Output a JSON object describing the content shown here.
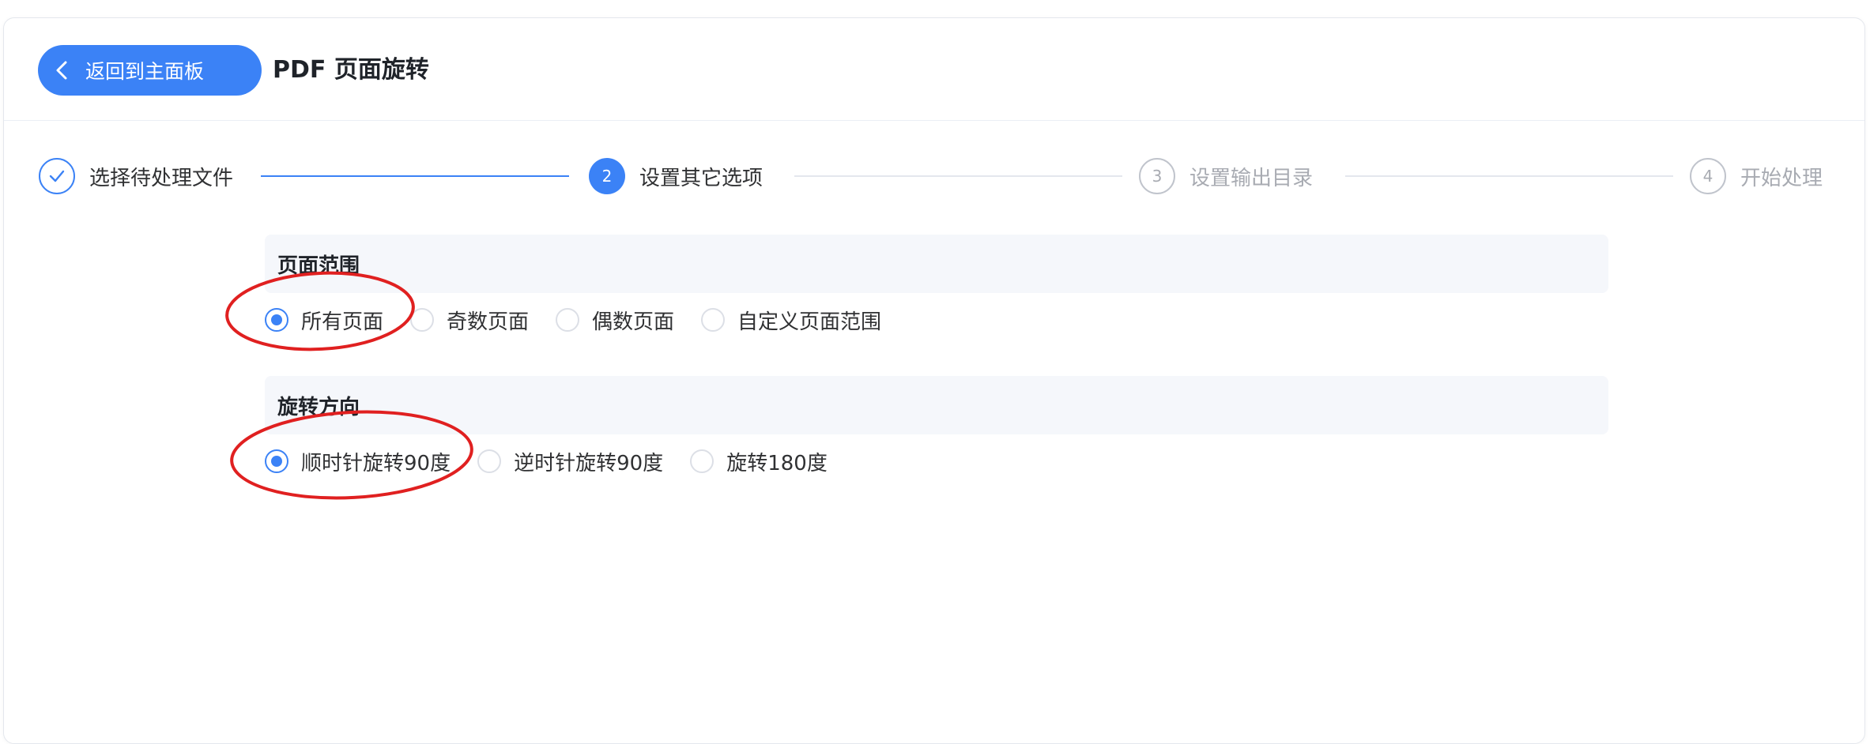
{
  "header": {
    "back_label": "返回到主面板",
    "title": "PDF 页面旋转"
  },
  "steps": [
    {
      "number": "✓",
      "label": "选择待处理文件",
      "state": "done"
    },
    {
      "number": "2",
      "label": "设置其它选项",
      "state": "active"
    },
    {
      "number": "3",
      "label": "设置输出目录",
      "state": "todo"
    },
    {
      "number": "4",
      "label": "开始处理",
      "state": "todo"
    }
  ],
  "page_range": {
    "title": "页面范围",
    "options": [
      "所有页面",
      "奇数页面",
      "偶数页面",
      "自定义页面范围"
    ],
    "selected": 0
  },
  "rotation": {
    "title": "旋转方向",
    "options": [
      "顺时针旋转90度",
      "逆时针旋转90度",
      "旋转180度"
    ],
    "selected": 0
  },
  "colors": {
    "accent": "#3b82f6",
    "annotation": "#e02020"
  }
}
